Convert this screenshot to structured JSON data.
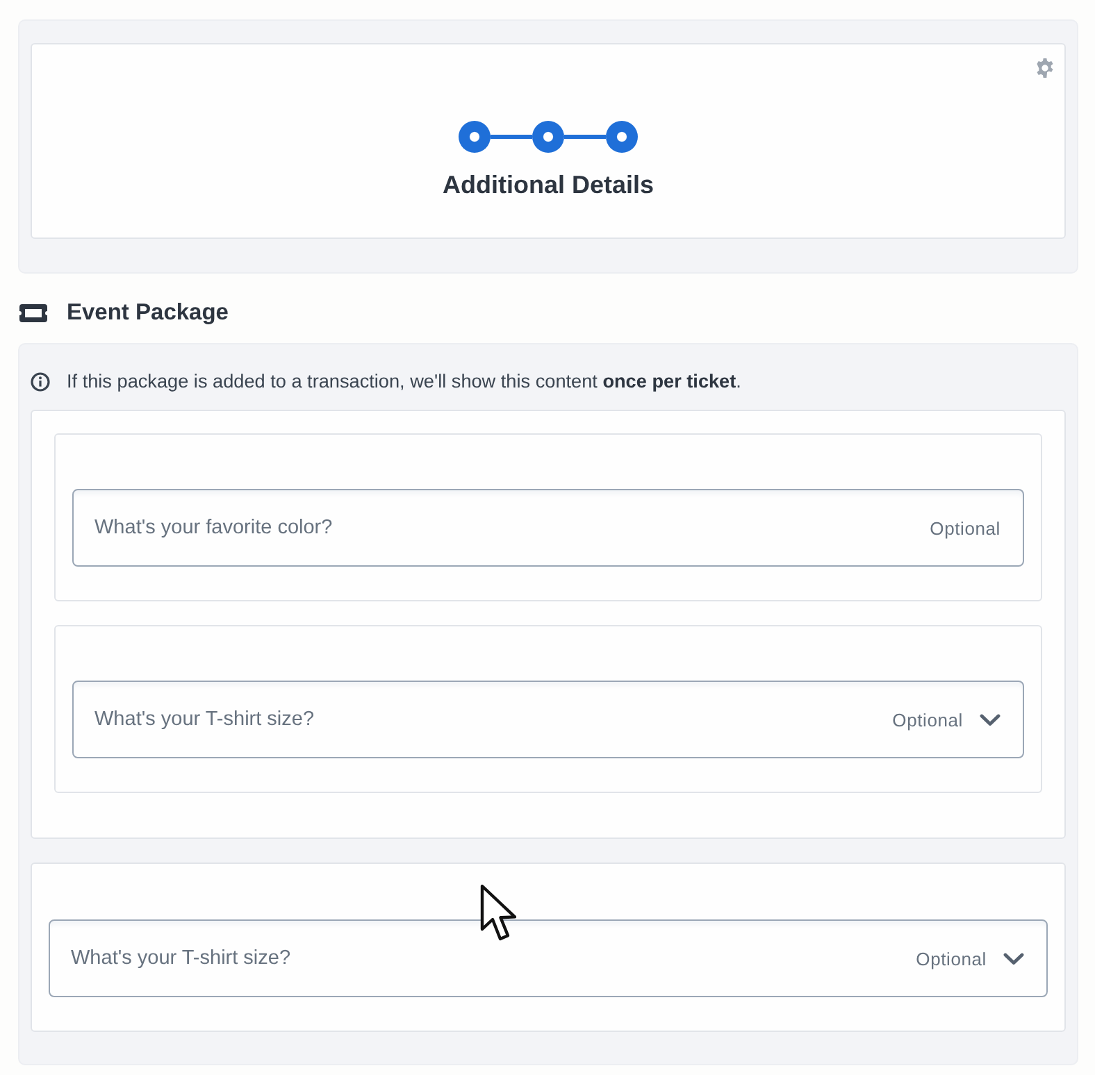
{
  "progress": {
    "steps": [
      {
        "complete": true
      },
      {
        "complete": true
      },
      {
        "complete": true
      }
    ],
    "title": "Additional Details"
  },
  "section": {
    "title": "Event Package"
  },
  "package": {
    "notice": "If this package is added to a transaction, we'll show this content **once per ticket**.",
    "cards": [
      {
        "kind": "grouped",
        "questions": [
          {
            "kind": "text",
            "placeholder": "What's your favorite color?",
            "hint": "Optional"
          },
          {
            "kind": "select",
            "placeholder": "What's your T-shirt size?",
            "hint": "Optional"
          }
        ]
      },
      {
        "kind": "plain",
        "questions": [
          {
            "kind": "select",
            "placeholder": "What's your T-shirt size?",
            "hint": "Optional"
          }
        ]
      }
    ]
  }
}
